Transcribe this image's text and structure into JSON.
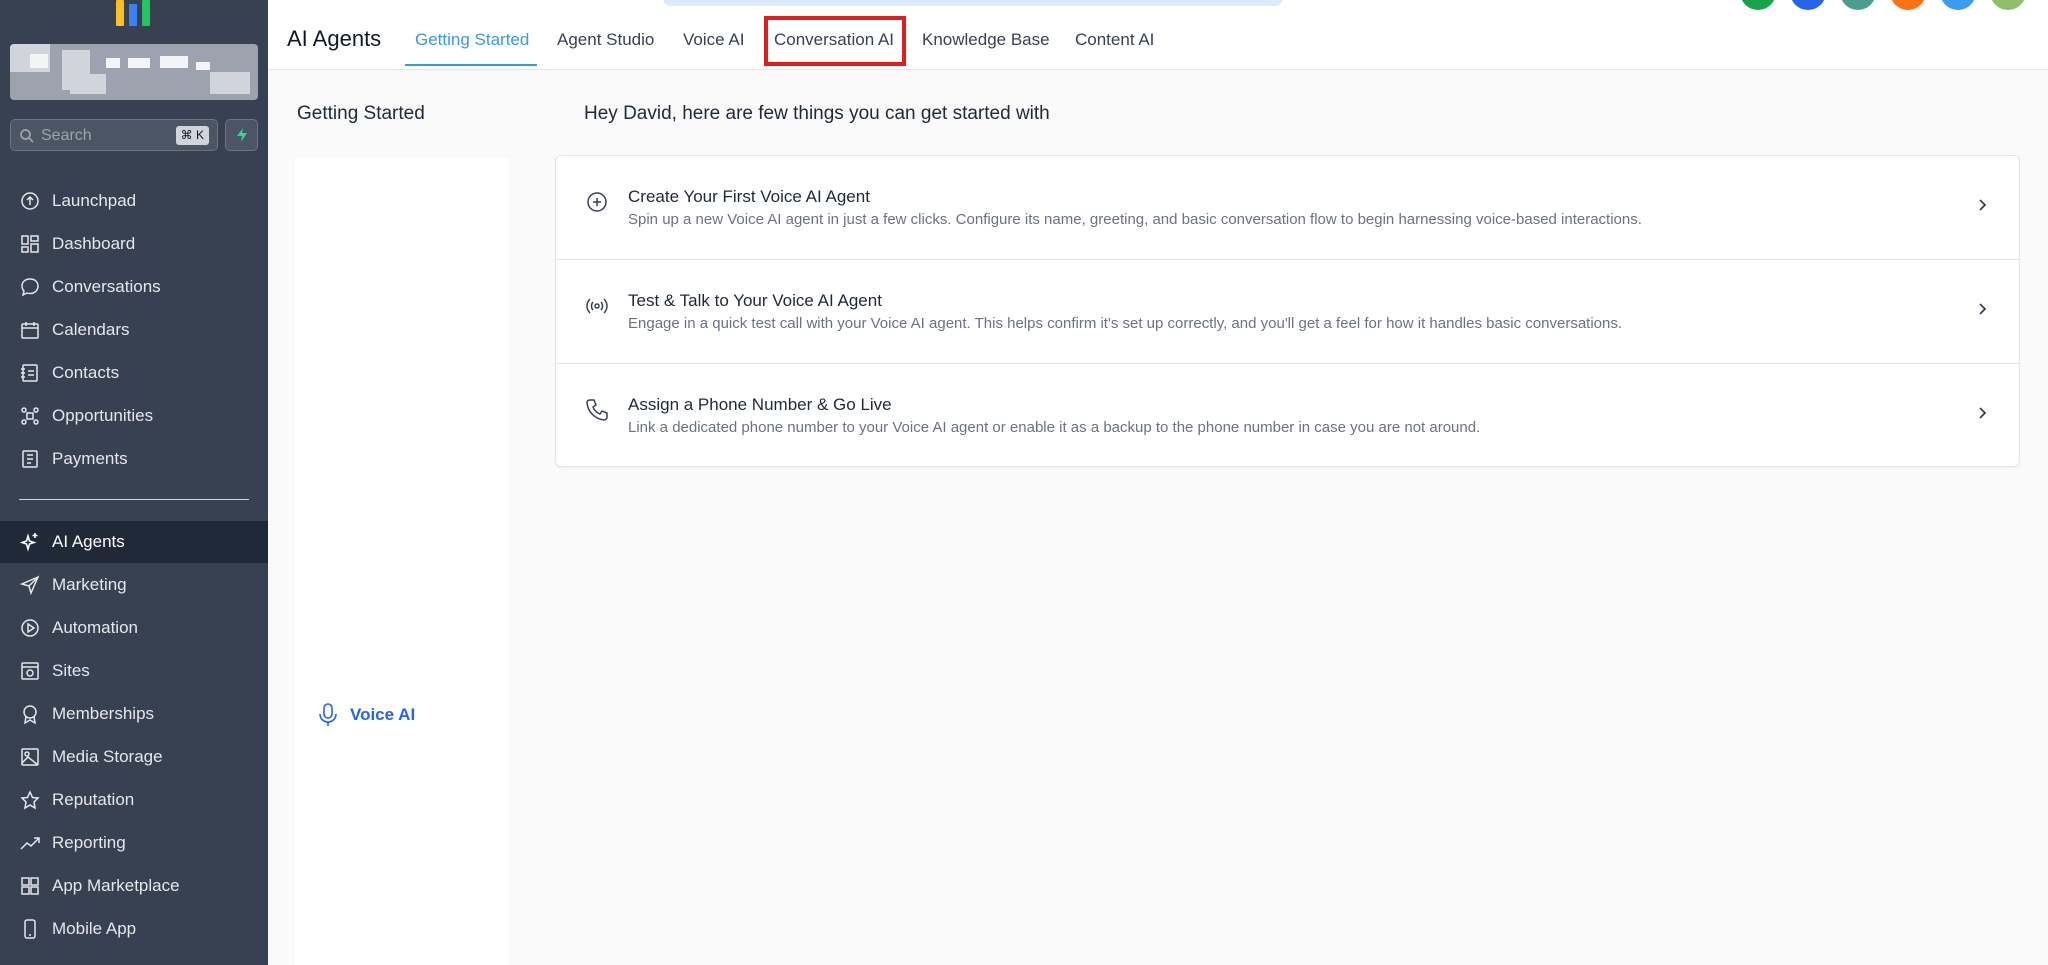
{
  "sidebar": {
    "search": {
      "placeholder": "Search",
      "shortcut": "⌘ K"
    },
    "items": [
      {
        "label": "Launchpad",
        "icon": "launchpad-icon"
      },
      {
        "label": "Dashboard",
        "icon": "dashboard-icon"
      },
      {
        "label": "Conversations",
        "icon": "chat-bubble-icon"
      },
      {
        "label": "Calendars",
        "icon": "calendar-icon"
      },
      {
        "label": "Contacts",
        "icon": "contacts-icon"
      },
      {
        "label": "Opportunities",
        "icon": "opportunities-icon"
      },
      {
        "label": "Payments",
        "icon": "payments-icon"
      }
    ],
    "items2": [
      {
        "label": "AI Agents",
        "icon": "sparkle-icon"
      },
      {
        "label": "Marketing",
        "icon": "send-icon"
      },
      {
        "label": "Automation",
        "icon": "automation-icon"
      },
      {
        "label": "Sites",
        "icon": "sites-icon"
      },
      {
        "label": "Memberships",
        "icon": "award-icon"
      },
      {
        "label": "Media Storage",
        "icon": "image-icon"
      },
      {
        "label": "Reputation",
        "icon": "star-icon"
      },
      {
        "label": "Reporting",
        "icon": "trending-up-icon"
      },
      {
        "label": "App Marketplace",
        "icon": "grid-icon"
      },
      {
        "label": "Mobile App",
        "icon": "mobile-icon"
      }
    ]
  },
  "header": {
    "title": "AI Agents",
    "tabs": [
      {
        "label": "Getting Started"
      },
      {
        "label": "Agent Studio"
      },
      {
        "label": "Voice AI"
      },
      {
        "label": "Conversation AI"
      },
      {
        "label": "Knowledge Base"
      },
      {
        "label": "Content AI"
      }
    ]
  },
  "subpanel": {
    "title": "Getting Started",
    "voice_link": "Voice AI"
  },
  "main": {
    "greeting": "Hey David, here are few things you can get started with",
    "steps": [
      {
        "title": "Create Your First Voice AI Agent",
        "description": "Spin up a new Voice AI agent in just a few clicks. Configure its name, greeting, and basic conversation flow to begin harnessing voice-based interactions.",
        "icon": "plus-circle-icon"
      },
      {
        "title": "Test & Talk to Your Voice AI Agent",
        "description": "Engage in a quick test call with your Voice AI agent. This helps confirm it's set up correctly, and you'll get a feel for how it handles basic conversations.",
        "icon": "broadcast-icon"
      },
      {
        "title": "Assign a Phone Number & Go Live",
        "description": "Link a dedicated phone number to your Voice AI agent or enable it as a backup to the phone number in case you are not around.",
        "icon": "phone-icon"
      }
    ]
  },
  "colors": {
    "sidebar_bg": "#374151",
    "accent": "#3b9ad9",
    "highlight": "#e11d1d",
    "link": "#2563eb"
  }
}
